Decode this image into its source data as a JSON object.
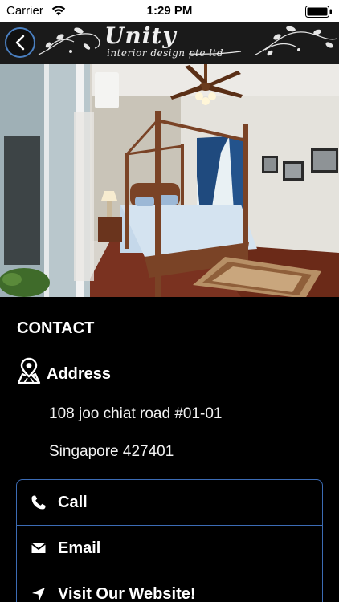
{
  "status_bar": {
    "carrier": "Carrier",
    "time": "1:29 PM"
  },
  "header": {
    "logo_title": "Unity",
    "logo_subtitle": "interior design pte ltd",
    "bar_color": "#1a1a1a",
    "back_button_color": "#4a7fc0"
  },
  "contact": {
    "heading": "CONTACT",
    "address_label": "Address",
    "address_line_1": "108 joo chiat road #01-01",
    "address_line_2": "Singapore 427401"
  },
  "actions": [
    {
      "label": "Call",
      "icon": "phone-icon"
    },
    {
      "label": "Email",
      "icon": "envelope-icon"
    },
    {
      "label": "Visit Our Website!",
      "icon": "location-arrow-icon"
    }
  ],
  "colors": {
    "background": "#000000",
    "accent_border": "#3c6cb5",
    "text": "#ffffff"
  }
}
